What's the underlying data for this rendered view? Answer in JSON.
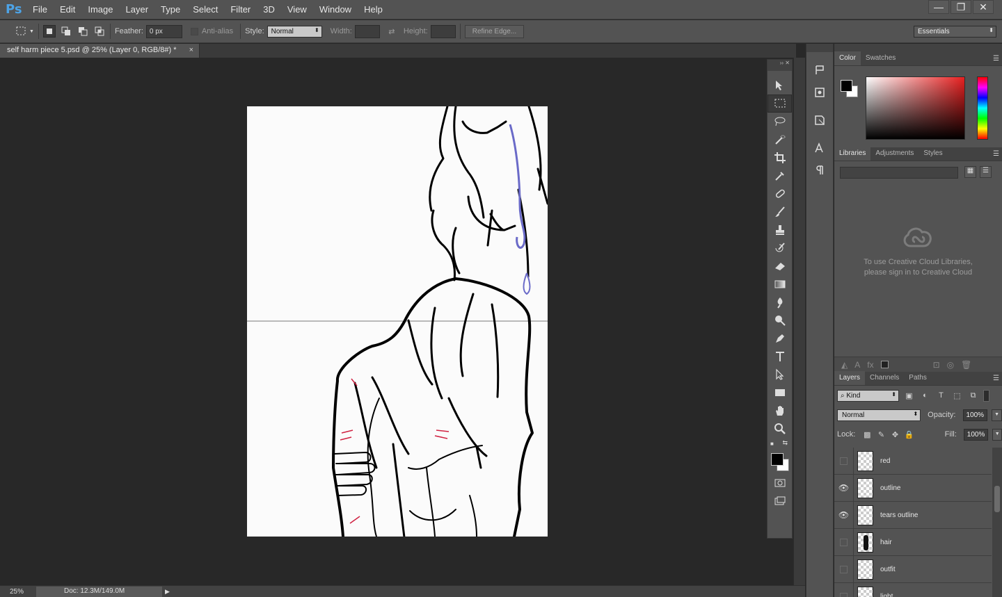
{
  "app": {
    "logo": "Ps"
  },
  "menu": [
    "File",
    "Edit",
    "Image",
    "Layer",
    "Type",
    "Select",
    "Filter",
    "3D",
    "View",
    "Window",
    "Help"
  ],
  "window_controls": [
    "—",
    "❐",
    "✕"
  ],
  "options": {
    "feather_label": "Feather:",
    "feather_value": "0 px",
    "antialias_label": "Anti-alias",
    "style_label": "Style:",
    "style_value": "Normal",
    "width_label": "Width:",
    "height_label": "Height:",
    "refine_edge": "Refine Edge...",
    "workspace": "Essentials"
  },
  "document": {
    "tab_title": "self harm piece 5.psd @ 25% (Layer 0, RGB/8#) *",
    "close": "×"
  },
  "status": {
    "zoom": "25%",
    "doc": "Doc: 12.3M/149.0M"
  },
  "panels": {
    "color_tabs": [
      "Color",
      "Swatches"
    ],
    "library_tabs": [
      "Libraries",
      "Adjustments",
      "Styles"
    ],
    "library_message_line1": "To use Creative Cloud Libraries,",
    "library_message_line2": "please sign in to Creative Cloud",
    "layers_tabs": [
      "Layers",
      "Channels",
      "Paths"
    ],
    "kind_label": "Kind",
    "blend_mode": "Normal",
    "opacity_label": "Opacity:",
    "opacity_value": "100%",
    "lock_label": "Lock:",
    "fill_label": "Fill:",
    "fill_value": "100%"
  },
  "layers": [
    {
      "name": "red",
      "visible": false
    },
    {
      "name": "outline",
      "visible": true
    },
    {
      "name": "tears outline",
      "visible": true
    },
    {
      "name": "hair",
      "visible": false
    },
    {
      "name": "outfit",
      "visible": false
    },
    {
      "name": "light",
      "visible": false
    }
  ],
  "colors": {
    "foreground": "#000000",
    "background": "#ffffff",
    "accent": "#4da3e6"
  }
}
